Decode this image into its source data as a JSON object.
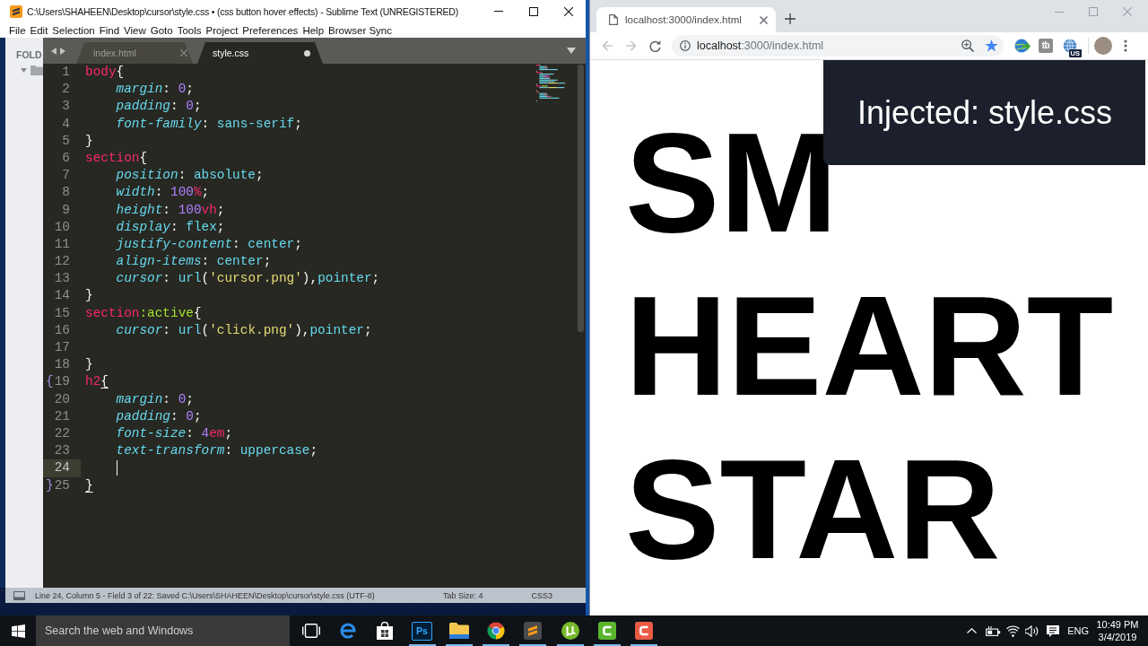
{
  "editor": {
    "title": "C:\\Users\\SHAHEEN\\Desktop\\cursor\\style.css • (css button hover effects) - Sublime Text (UNREGISTERED)",
    "menu": [
      "File",
      "Edit",
      "Selection",
      "Find",
      "View",
      "Goto",
      "Tools",
      "Project",
      "Preferences",
      "Help",
      "Browser Sync"
    ],
    "sidebar": {
      "heading": "FOLD",
      "expanded": true
    },
    "tabs": [
      {
        "label": "index.html",
        "selected": false,
        "modified": false
      },
      {
        "label": "style.css",
        "selected": true,
        "modified": true
      }
    ],
    "code": [
      {
        "number": "1",
        "current": false,
        "tokens": [
          {
            "kind": "sel",
            "text": "body"
          },
          {
            "kind": "punct",
            "text": "{"
          }
        ],
        "children": [
          {
            "number": "2",
            "current": false,
            "tokens": [
              {
                "kind": "prop",
                "text": "margin"
              },
              {
                "kind": "punct",
                "text": ": "
              },
              {
                "kind": "num",
                "text": "0"
              },
              {
                "kind": "punct",
                "text": ";"
              }
            ]
          },
          {
            "number": "3",
            "current": false,
            "tokens": [
              {
                "kind": "prop",
                "text": "padding"
              },
              {
                "kind": "punct",
                "text": ": "
              },
              {
                "kind": "num",
                "text": "0"
              },
              {
                "kind": "punct",
                "text": ";"
              }
            ]
          },
          {
            "number": "4",
            "current": false,
            "tokens": [
              {
                "kind": "prop",
                "text": "font-family"
              },
              {
                "kind": "punct",
                "text": ": "
              },
              {
                "kind": "kw",
                "text": "sans-serif"
              },
              {
                "kind": "punct",
                "text": ";"
              }
            ]
          }
        ]
      },
      {
        "number": "5",
        "current": false,
        "tokens": [
          {
            "kind": "punct",
            "text": "}"
          }
        ]
      },
      {
        "number": "6",
        "current": false,
        "tokens": [
          {
            "kind": "sel",
            "text": "section"
          },
          {
            "kind": "punct",
            "text": "{"
          }
        ],
        "children": [
          {
            "number": "7",
            "current": false,
            "tokens": [
              {
                "kind": "prop",
                "text": "position"
              },
              {
                "kind": "punct",
                "text": ": "
              },
              {
                "kind": "kw",
                "text": "absolute"
              },
              {
                "kind": "punct",
                "text": ";"
              }
            ]
          },
          {
            "number": "8",
            "current": false,
            "tokens": [
              {
                "kind": "prop",
                "text": "width"
              },
              {
                "kind": "punct",
                "text": ": "
              },
              {
                "kind": "num",
                "text": "100"
              },
              {
                "kind": "unit",
                "text": "%"
              },
              {
                "kind": "punct",
                "text": ";"
              }
            ]
          },
          {
            "number": "9",
            "current": false,
            "tokens": [
              {
                "kind": "prop",
                "text": "height"
              },
              {
                "kind": "punct",
                "text": ": "
              },
              {
                "kind": "num",
                "text": "100"
              },
              {
                "kind": "unit",
                "text": "vh"
              },
              {
                "kind": "punct",
                "text": ";"
              }
            ]
          },
          {
            "number": "10",
            "current": false,
            "tokens": [
              {
                "kind": "prop",
                "text": "display"
              },
              {
                "kind": "punct",
                "text": ": "
              },
              {
                "kind": "kw",
                "text": "flex"
              },
              {
                "kind": "punct",
                "text": ";"
              }
            ]
          },
          {
            "number": "11",
            "current": false,
            "tokens": [
              {
                "kind": "prop",
                "text": "justify-content"
              },
              {
                "kind": "punct",
                "text": ": "
              },
              {
                "kind": "kw",
                "text": "center"
              },
              {
                "kind": "punct",
                "text": ";"
              }
            ]
          },
          {
            "number": "12",
            "current": false,
            "tokens": [
              {
                "kind": "prop",
                "text": "align-items"
              },
              {
                "kind": "punct",
                "text": ": "
              },
              {
                "kind": "kw",
                "text": "center"
              },
              {
                "kind": "punct",
                "text": ";"
              }
            ]
          },
          {
            "number": "13",
            "current": false,
            "tokens": [
              {
                "kind": "prop",
                "text": "cursor"
              },
              {
                "kind": "punct",
                "text": ": "
              },
              {
                "kind": "fn",
                "text": "url"
              },
              {
                "kind": "punct",
                "text": "("
              },
              {
                "kind": "str",
                "text": "'cursor.png'"
              },
              {
                "kind": "punct",
                "text": "),"
              },
              {
                "kind": "kw",
                "text": "pointer"
              },
              {
                "kind": "punct",
                "text": ";"
              }
            ]
          }
        ]
      },
      {
        "number": "14",
        "current": false,
        "tokens": [
          {
            "kind": "punct",
            "text": "}"
          }
        ]
      },
      {
        "number": "15",
        "current": false,
        "tokens": [
          {
            "kind": "sel",
            "text": "section"
          },
          {
            "kind": "pseudo",
            "text": ":active"
          },
          {
            "kind": "punct",
            "text": "{"
          }
        ],
        "children": [
          {
            "number": "16",
            "current": false,
            "tokens": [
              {
                "kind": "prop",
                "text": "cursor"
              },
              {
                "kind": "punct",
                "text": ": "
              },
              {
                "kind": "fn",
                "text": "url"
              },
              {
                "kind": "punct",
                "text": "("
              },
              {
                "kind": "str",
                "text": "'click.png'"
              },
              {
                "kind": "punct",
                "text": "),"
              },
              {
                "kind": "kw",
                "text": "pointer"
              },
              {
                "kind": "punct",
                "text": ";"
              }
            ]
          },
          {
            "number": "17",
            "current": false
          }
        ]
      },
      {
        "number": "18",
        "current": false,
        "tokens": [
          {
            "kind": "punct",
            "text": "}"
          }
        ]
      },
      {
        "number": "19",
        "current": false,
        "fold": "{",
        "tokens": [
          {
            "kind": "sel",
            "text": "h2"
          },
          {
            "kind": "match",
            "text": "{"
          }
        ],
        "children": [
          {
            "number": "20",
            "current": false,
            "tokens": [
              {
                "kind": "prop",
                "text": "margin"
              },
              {
                "kind": "punct",
                "text": ": "
              },
              {
                "kind": "num",
                "text": "0"
              },
              {
                "kind": "punct",
                "text": ";"
              }
            ]
          },
          {
            "number": "21",
            "current": false,
            "tokens": [
              {
                "kind": "prop",
                "text": "padding"
              },
              {
                "kind": "punct",
                "text": ": "
              },
              {
                "kind": "num",
                "text": "0"
              },
              {
                "kind": "punct",
                "text": ";"
              }
            ]
          },
          {
            "number": "22",
            "current": false,
            "tokens": [
              {
                "kind": "prop",
                "text": "font-size"
              },
              {
                "kind": "punct",
                "text": ": "
              },
              {
                "kind": "num",
                "text": "4"
              },
              {
                "kind": "unit",
                "text": "em"
              },
              {
                "kind": "punct",
                "text": ";"
              }
            ]
          },
          {
            "number": "23",
            "current": false,
            "tokens": [
              {
                "kind": "prop",
                "text": "text-transform"
              },
              {
                "kind": "punct",
                "text": ": "
              },
              {
                "kind": "kw",
                "text": "uppercase"
              },
              {
                "kind": "punct",
                "text": ";"
              }
            ]
          },
          {
            "number": "24",
            "current": true,
            "tokens": [
              {
                "kind": "caret"
              }
            ]
          }
        ]
      },
      {
        "number": "25",
        "current": false,
        "fold": "}",
        "tokens": [
          {
            "kind": "match",
            "text": "}"
          }
        ]
      }
    ],
    "status_bar": {
      "message": "Line 24, Column 5 - Field 3 of 22: Saved C:\\Users\\SHAHEEN\\Desktop\\cursor\\style.css (UTF-8)",
      "tab_size": "Tab Size: 4",
      "syntax": "CSS3"
    }
  },
  "browser": {
    "tab_title": "localhost:3000/index.html",
    "nav": {
      "back_disabled": true,
      "forward_disabled": true
    },
    "address": {
      "host": "localhost",
      "path": ":3000/index.html"
    },
    "bookmarked": true,
    "extensions": [
      {
        "kind": "globe-arrow"
      },
      {
        "kind": "letters",
        "label": "tb"
      },
      {
        "kind": "globe",
        "badge": "US"
      }
    ],
    "page": {
      "headings": [
        "SM",
        "HEART",
        "STAR"
      ],
      "notification": "Injected: style.css"
    }
  },
  "taskbar": {
    "search_placeholder": "Search the web and Windows",
    "apps": [
      {
        "kind": "taskview",
        "running": false
      },
      {
        "kind": "edge",
        "running": false
      },
      {
        "kind": "store",
        "running": false
      },
      {
        "kind": "photoshop",
        "label": "Ps",
        "running": true
      },
      {
        "kind": "files",
        "running": true
      },
      {
        "kind": "chrome",
        "running": true
      },
      {
        "kind": "sublime",
        "running": true
      },
      {
        "kind": "torrent",
        "running": true
      },
      {
        "kind": "camtasia",
        "color": "#5ab52d",
        "running": true
      },
      {
        "kind": "camtasia",
        "color": "#e95b45",
        "running": true
      }
    ],
    "language": "ENG",
    "time": "10:49 PM",
    "date": "3/4/2019"
  }
}
